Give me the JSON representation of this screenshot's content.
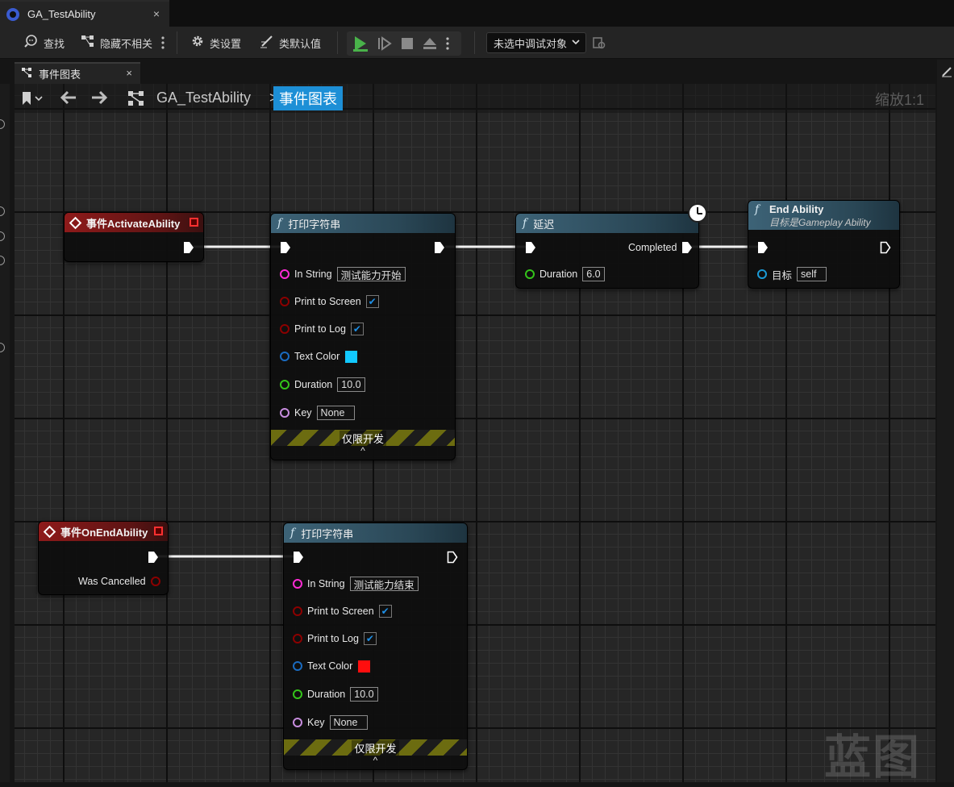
{
  "window": {
    "doc_tab_title": "GA_TestAbility",
    "close_glyph": "×"
  },
  "toolbar": {
    "find_label": "查找",
    "hide_unrelated_label": "隐藏不相关",
    "class_settings_label": "类设置",
    "class_defaults_label": "类默认值",
    "debug_object_value": "未选中调试对象"
  },
  "graph_tab": {
    "label": "事件图表"
  },
  "breadcrumb": {
    "blueprint": "GA_TestAbility",
    "separator": ">",
    "current": "事件图表",
    "zoom": "缩放1:1"
  },
  "nodes": {
    "activate": {
      "title": "事件ActivateAbility"
    },
    "print1": {
      "title": "打印字符串",
      "in_string_label": "In String",
      "in_string_value": "测试能力开始",
      "print_screen_label": "Print to Screen",
      "print_screen_checked": "✔",
      "print_log_label": "Print to Log",
      "print_log_checked": "✔",
      "text_color_label": "Text Color",
      "text_color": "#12c9ff",
      "duration_label": "Duration",
      "duration_value": "10.0",
      "key_label": "Key",
      "key_value": "None",
      "dev_only": "仅限开发",
      "caret": "^"
    },
    "delay": {
      "title": "延迟",
      "completed_label": "Completed",
      "duration_label": "Duration",
      "duration_value": "6.0"
    },
    "end_ability": {
      "title": "End Ability",
      "subtitle": "目标是Gameplay Ability",
      "target_label": "目标",
      "target_value": "self"
    },
    "on_end": {
      "title": "事件OnEndAbility",
      "was_cancelled_label": "Was Cancelled"
    },
    "print2": {
      "title": "打印字符串",
      "in_string_label": "In String",
      "in_string_value": "测试能力结束",
      "print_screen_label": "Print to Screen",
      "print_screen_checked": "✔",
      "print_log_label": "Print to Log",
      "print_log_checked": "✔",
      "text_color_label": "Text Color",
      "text_color": "#ff0e0e",
      "duration_label": "Duration",
      "duration_value": "10.0",
      "key_label": "Key",
      "key_value": "None",
      "dev_only": "仅限开发",
      "caret": "^"
    }
  },
  "pin_colors": {
    "string": "#ff2bd4",
    "bool": "#8c0000",
    "struct": "#1a6bc0",
    "float": "#34c41a",
    "name": "#c88ddf",
    "object": "#1a9ad6"
  },
  "watermark": "蓝图"
}
